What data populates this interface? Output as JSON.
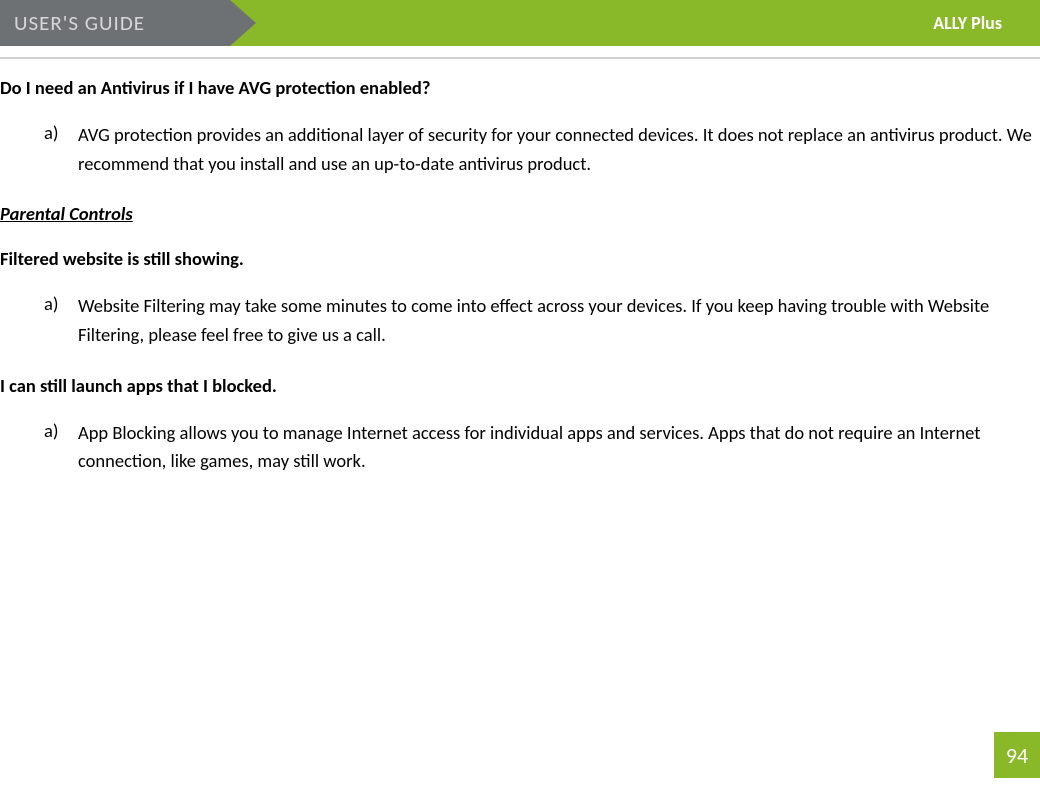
{
  "header": {
    "left_title": "USER'S GUIDE",
    "right_title": "ALLY Plus"
  },
  "sections": {
    "q1": {
      "heading": "Do I need an Antivirus if I have AVG protection enabled?",
      "item_a_marker": "a)",
      "item_a_text": "AVG protection provides an additional layer of security for your connected devices. It does not replace an antivirus product. We recommend that you install and use an up-to-date antivirus product."
    },
    "parental_title": "Parental Controls",
    "q2": {
      "heading": "Filtered website is still showing.",
      "item_a_marker": "a)",
      "item_a_text": "Website Filtering may take some minutes to come into effect across your devices. If you keep having trouble with Website Filtering, please feel free to give us a call."
    },
    "q3": {
      "heading": "I can still launch apps that I blocked.",
      "item_a_marker": "a)",
      "item_a_text": "App Blocking allows you to manage Internet access for individual apps and services. Apps that do not require an Internet connection, like games, may still work."
    }
  },
  "page_number": "94"
}
